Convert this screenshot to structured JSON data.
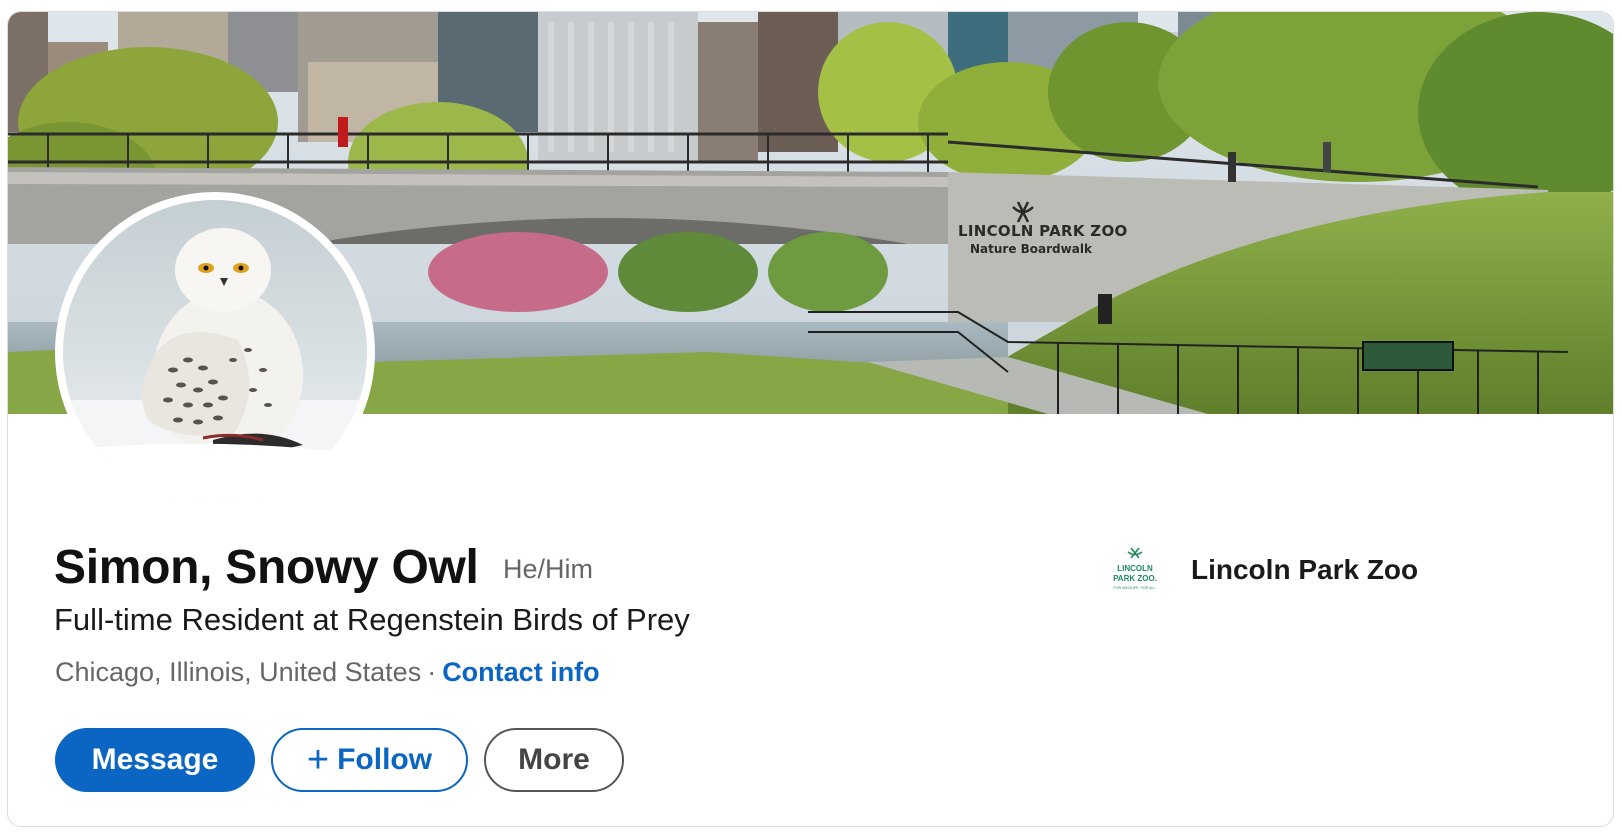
{
  "profile": {
    "name": "Simon, Snowy Owl",
    "pronouns": "He/Him",
    "headline": "Full-time Resident at Regenstein Birds of Prey",
    "location": "Chicago, Illinois, United States",
    "separator": "·",
    "contact_label": "Contact info"
  },
  "banner": {
    "sign_line1": "LINCOLN PARK ZOO",
    "sign_line2": "Nature Boardwalk"
  },
  "actions": {
    "message_label": "Message",
    "follow_icon": "+",
    "follow_label": "Follow",
    "more_label": "More"
  },
  "company": {
    "name": "Lincoln Park Zoo",
    "logo_line1": "LINCOLN",
    "logo_line2": "PARK ZOO.",
    "logo_tagline": "FOR WILDLIFE. FOR ALL."
  },
  "colors": {
    "accent": "#0a66c2",
    "brand_green": "#1f8a5b"
  }
}
